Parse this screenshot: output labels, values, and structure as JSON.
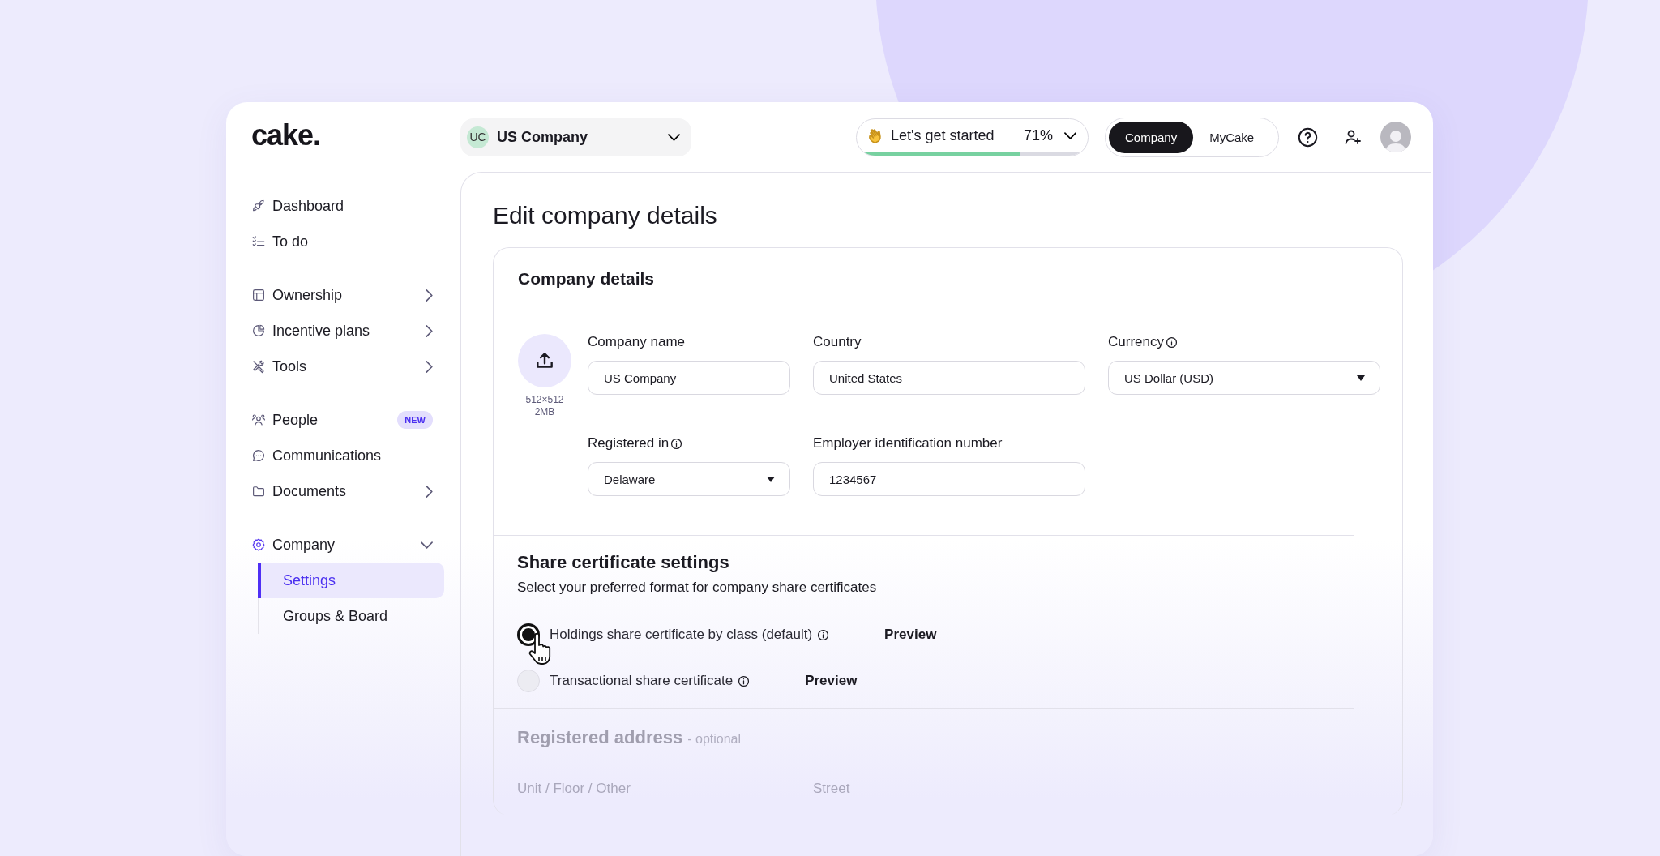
{
  "logo": "cake.",
  "company_selector": {
    "initials": "UC",
    "name": "US Company"
  },
  "onboarding": {
    "label": "Let's get started",
    "percent": "71%",
    "level": 0.71
  },
  "view_toggle": [
    {
      "label": "Company",
      "selected": true
    },
    {
      "label": "MyCake",
      "selected": false
    }
  ],
  "sidebar": {
    "groups": [
      [
        {
          "label": "Dashboard",
          "selected": false
        },
        {
          "label": "To do",
          "selected": false
        }
      ],
      [
        {
          "label": "Ownership",
          "selected": false,
          "expanded": false
        },
        {
          "label": "Incentive plans",
          "selected": false,
          "expanded": false
        },
        {
          "label": "Tools",
          "selected": false,
          "expanded": false
        }
      ],
      [
        {
          "label": "People",
          "selected": false,
          "badge": "NEW"
        },
        {
          "label": "Communications",
          "selected": false
        },
        {
          "label": "Documents",
          "selected": false,
          "expanded": false
        }
      ],
      [
        {
          "label": "Company",
          "selected": false,
          "expanded": true,
          "children": [
            {
              "label": "Settings",
              "selected": true
            },
            {
              "label": "Groups & Board",
              "selected": false
            }
          ]
        }
      ]
    ]
  },
  "page_title": "Edit company details",
  "company_details": {
    "title": "Company details",
    "upload": {
      "size": "512×512",
      "limit": "2MB"
    },
    "fields": [
      {
        "label": "Company name",
        "value": "US Company",
        "kind": "text"
      },
      {
        "label": "Country",
        "value": "United States",
        "kind": "text"
      },
      {
        "label": "Currency",
        "value": "US Dollar (USD)",
        "kind": "select",
        "info": true
      },
      {
        "label": "Registered in",
        "value": "Delaware",
        "kind": "select",
        "info": true
      },
      {
        "label": "Employer identification number",
        "value": "1234567",
        "kind": "text"
      }
    ]
  },
  "share_certificates": {
    "title": "Share certificate settings",
    "subtitle": "Select your preferred format for company share certificates",
    "options": [
      {
        "label": "Holdings share certificate by class (default)",
        "selected": true,
        "action": "Preview"
      },
      {
        "label": "Transactional share certificate",
        "selected": false,
        "action": "Preview"
      }
    ]
  },
  "registered_address": {
    "title": "Registered address",
    "note": "- optional",
    "fields": [
      "Unit / Floor / Other",
      "Street"
    ]
  }
}
